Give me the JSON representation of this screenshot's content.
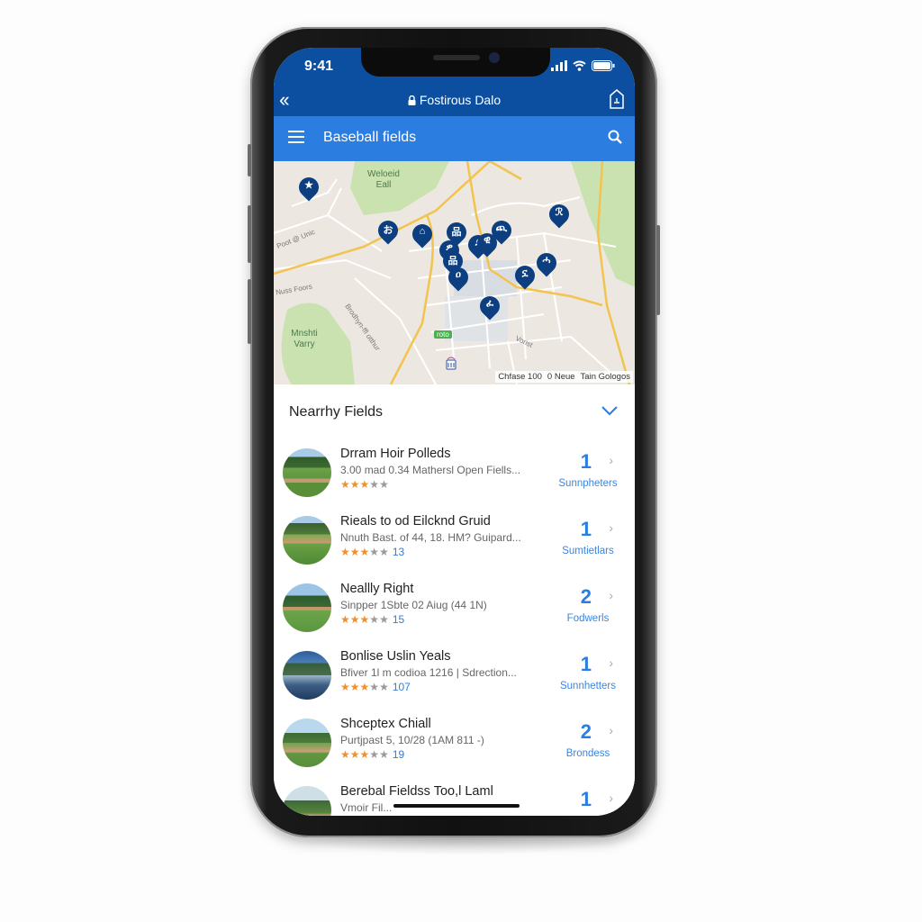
{
  "status_bar": {
    "time": "9:41"
  },
  "browser": {
    "url": "Fostirous Dalo",
    "back_icon": "double-chevron-left-icon",
    "share_icon": "share-icon"
  },
  "app_bar": {
    "title": "Baseball fields",
    "menu_icon": "hamburger-menu-icon",
    "search_icon": "search-icon"
  },
  "map": {
    "labels": [
      "Weloeid Eall",
      "Mnshti Varry",
      "Poot @ Unic",
      "Brodhyn-ffl otthur",
      "Nuss Foors",
      "Vorist",
      "roto"
    ],
    "pins": [
      "★",
      "お",
      "⌂",
      "品",
      "ዎ",
      "ያ",
      "品",
      "ዊ",
      "ዐ",
      "ጪ",
      "ኗ",
      "ℛ",
      "ሓ",
      "ፈ"
    ],
    "attribution": [
      "Chfase 100",
      "0 Neue",
      "Tain Gologos"
    ]
  },
  "nearby": {
    "header": "Nearrhy Fields",
    "items": [
      {
        "name": "Drram Hoir Polleds",
        "subtitle": "3.00 mad 0.34 Mathersl Open Fiells...",
        "stars": 3,
        "reviews": "",
        "count": "1",
        "category": "Sunnpheters"
      },
      {
        "name": "Rieals to od Eilcknd Gruid",
        "subtitle": "Nnuth Bast. of 44, 18. HM? Guipard...",
        "stars": 3,
        "reviews": "13",
        "count": "1",
        "category": "Sumtietlars"
      },
      {
        "name": "Neallly Right",
        "subtitle": "Sinpper 1Sbte 02 Aiug (44 1N)",
        "stars": 3,
        "reviews": "15",
        "count": "2",
        "category": "Fodwerls"
      },
      {
        "name": "Bonlise Uslin Yeals",
        "subtitle": "Bfiver 1l m codioa 1216 | Sdrection...",
        "stars": 3,
        "reviews": "107",
        "count": "1",
        "category": "Sunnhetters"
      },
      {
        "name": "Shceptex Chiall",
        "subtitle": "Purtjpast 5, 10/28 (1AM 811 -)",
        "stars": 3,
        "reviews": "19",
        "count": "2",
        "category": "Brondess"
      },
      {
        "name": "Berebal Fieldss Too,l Laml",
        "subtitle": "Vmoir Fil...",
        "stars": 0,
        "reviews": "",
        "count": "1",
        "category": ""
      }
    ]
  },
  "colors": {
    "header_dark": "#0c4fa0",
    "header_light": "#2b7de0",
    "pin": "#0d3f80",
    "star": "#f0902a"
  }
}
